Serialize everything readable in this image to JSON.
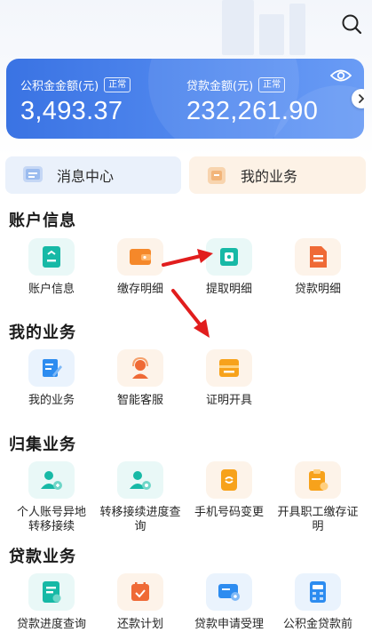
{
  "account_card": {
    "provident_label": "公积金金额(元)",
    "provident_badge": "正常",
    "provident_value": "3,493.37",
    "loan_label": "贷款金额(元)",
    "loan_badge": "正常",
    "loan_value": "232,261.90"
  },
  "quick_actions": {
    "messages": "消息中心",
    "my_business": "我的业务"
  },
  "sections": {
    "account": {
      "title": "账户信息",
      "items": [
        "账户信息",
        "缴存明细",
        "提取明细",
        "贷款明细"
      ]
    },
    "business": {
      "title": "我的业务",
      "items": [
        "我的业务",
        "智能客服",
        "证明开具"
      ]
    },
    "collection": {
      "title": "归集业务",
      "items": [
        "个人账号异地转移接续",
        "转移接续进度查询",
        "手机号码变更",
        "开具职工缴存证明"
      ]
    },
    "loan": {
      "title": "贷款业务",
      "items": [
        "贷款进度查询",
        "还款计划",
        "贷款申请受理",
        "公积金贷款前"
      ]
    }
  },
  "colors": {
    "card_blue": "#3a73e3",
    "teal": "#17b9a6",
    "orange": "#f5882a",
    "blue": "#2d8cf0",
    "arrow_red": "#e11d1d"
  }
}
